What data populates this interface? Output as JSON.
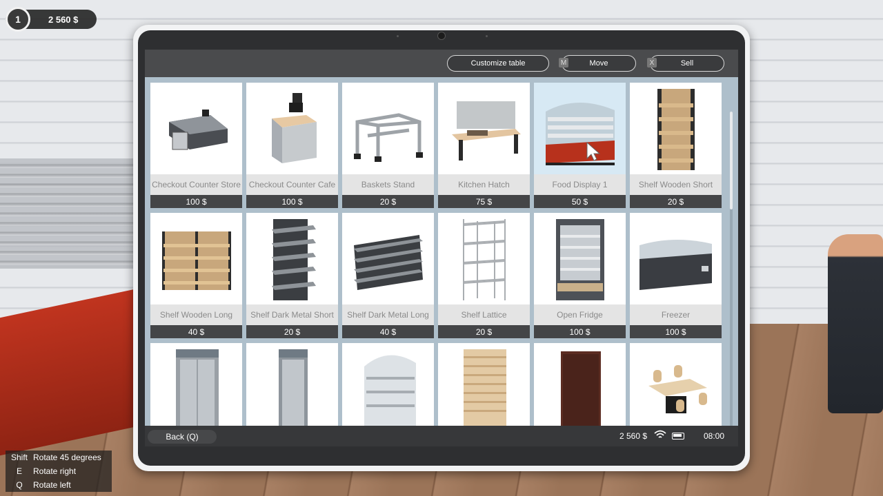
{
  "hud": {
    "level": "1",
    "money": "2 560 $"
  },
  "key_hints": [
    {
      "key": "Shift",
      "action": "Rotate 45 degrees"
    },
    {
      "key": "E",
      "action": "Rotate right"
    },
    {
      "key": "Q",
      "action": "Rotate left"
    }
  ],
  "toolbar": {
    "customize_label": "Customize table",
    "move_key": "M",
    "move_label": "Move",
    "sell_key": "X",
    "sell_label": "Sell"
  },
  "catalog": [
    {
      "name": "Checkout Counter Store",
      "price": "100 $",
      "icon": "checkout-counter-icon"
    },
    {
      "name": "Checkout Counter Cafe",
      "price": "100 $",
      "icon": "cafe-counter-icon"
    },
    {
      "name": "Baskets Stand",
      "price": "20 $",
      "icon": "baskets-stand-icon"
    },
    {
      "name": "Kitchen Hatch",
      "price": "75 $",
      "icon": "kitchen-hatch-icon"
    },
    {
      "name": "Food Display 1",
      "price": "50 $",
      "icon": "food-display-icon",
      "selected": true
    },
    {
      "name": "Shelf Wooden Short",
      "price": "20 $",
      "icon": "wooden-shelf-icon"
    },
    {
      "name": "Shelf Wooden Long",
      "price": "40 $",
      "icon": "wooden-long-shelf-icon"
    },
    {
      "name": "Shelf Dark Metal Short",
      "price": "20 $",
      "icon": "dark-metal-shelf-icon"
    },
    {
      "name": "Shelf Dark Metal Long",
      "price": "40 $",
      "icon": "dark-metal-long-shelf-icon"
    },
    {
      "name": "Shelf Lattice",
      "price": "20 $",
      "icon": "lattice-shelf-icon"
    },
    {
      "name": "Open Fridge",
      "price": "100 $",
      "icon": "open-fridge-icon"
    },
    {
      "name": "Freezer",
      "price": "100 $",
      "icon": "freezer-icon"
    },
    {
      "name": "",
      "price": "",
      "icon": "glass-door-fridge-icon"
    },
    {
      "name": "",
      "price": "",
      "icon": "single-door-fridge-icon"
    },
    {
      "name": "",
      "price": "",
      "icon": "curved-display-icon"
    },
    {
      "name": "",
      "price": "",
      "icon": "slatwall-panel-icon"
    },
    {
      "name": "",
      "price": "",
      "icon": "dark-wood-shelf-icon"
    },
    {
      "name": "",
      "price": "",
      "icon": "table-chairs-icon"
    }
  ],
  "statusbar": {
    "back_label": "Back (Q)",
    "money": "2 560 $",
    "time": "08:00"
  },
  "colors": {
    "grid_background": "#aebfcb",
    "price_bar": "#444547",
    "selected_card": "#d7e9f4"
  }
}
